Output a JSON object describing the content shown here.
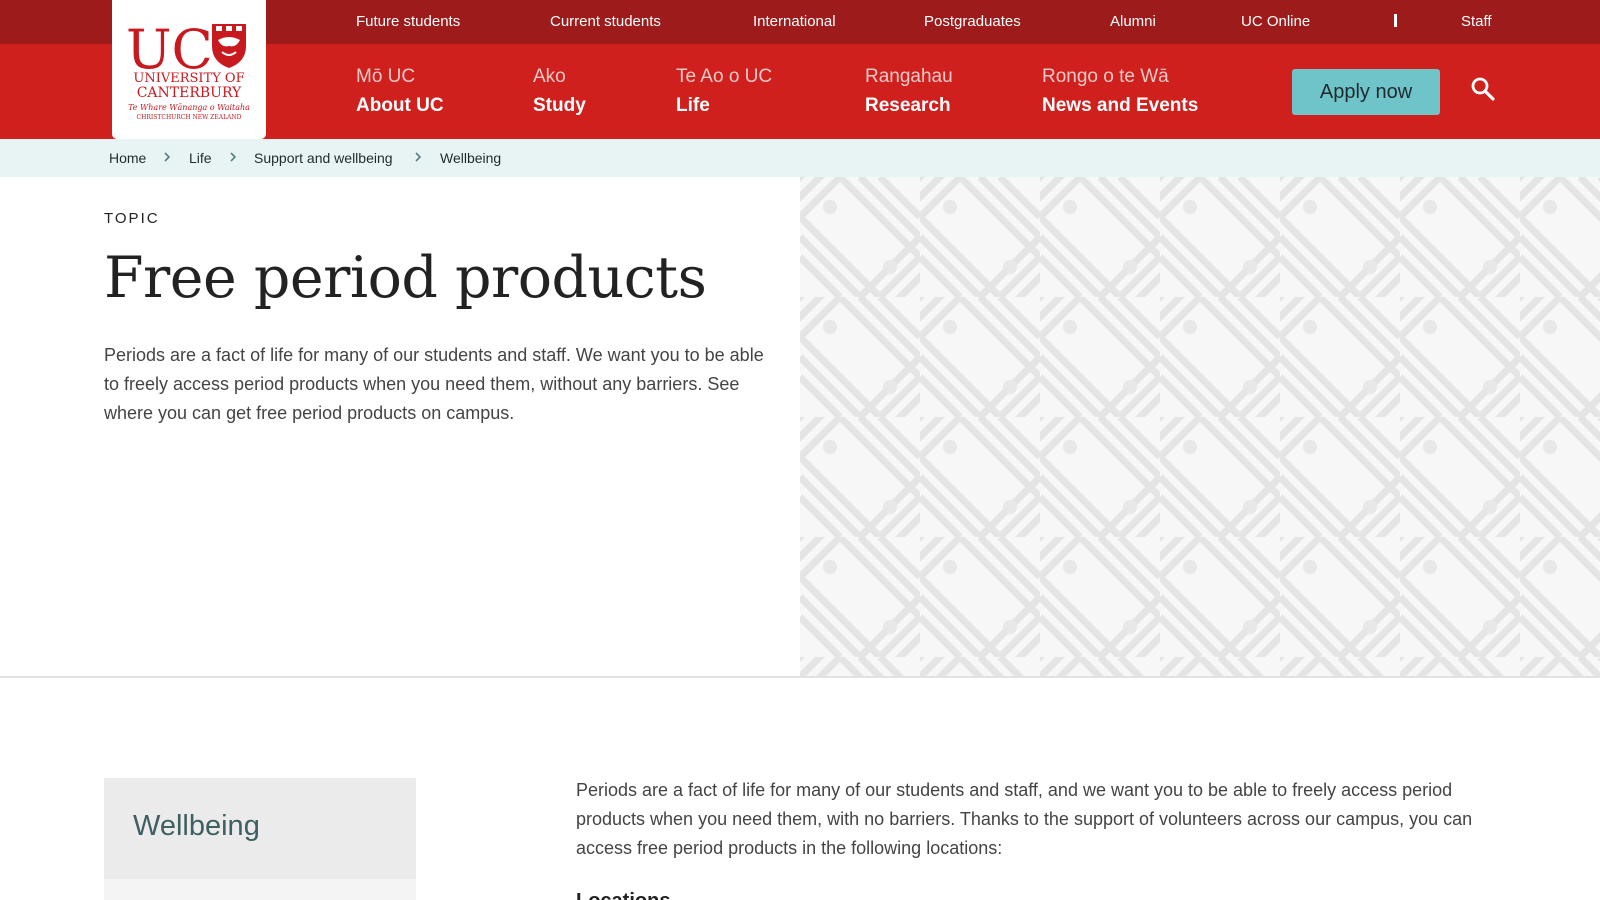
{
  "utility_nav": {
    "items": [
      {
        "label": "Future students"
      },
      {
        "label": "Current students"
      },
      {
        "label": "International"
      },
      {
        "label": "Postgraduates"
      },
      {
        "label": "Alumni"
      },
      {
        "label": "UC Online"
      },
      {
        "label": "Staff"
      }
    ]
  },
  "logo": {
    "line1": "UC",
    "line2": "UNIVERSITY OF",
    "line3": "CANTERBURY",
    "line4": "Te Whare Wānanga o Waitaha",
    "line5": "CHRISTCHURCH NEW ZEALAND",
    "icon": "university-crest-icon"
  },
  "main_nav": {
    "items": [
      {
        "maori": "Mō UC",
        "english": "About UC"
      },
      {
        "maori": "Ako",
        "english": "Study"
      },
      {
        "maori": "Te Ao o UC",
        "english": "Life"
      },
      {
        "maori": "Rangahau",
        "english": "Research"
      },
      {
        "maori": "Rongo o te Wā",
        "english": "News and Events"
      }
    ],
    "apply_label": "Apply now",
    "search_icon": "search-icon"
  },
  "breadcrumb": {
    "items": [
      {
        "label": "Home"
      },
      {
        "label": "Life"
      },
      {
        "label": "Support and wellbeing"
      },
      {
        "label": "Wellbeing"
      }
    ],
    "separator_icon": "chevron-right-icon"
  },
  "hero": {
    "eyebrow": "TOPIC",
    "title": "Free period products",
    "intro": "Periods are a fact of life for many of our students and staff. We want you to be able to freely access period products when you need them, without any barriers. See where you can get free period products on campus.",
    "pattern_icon": "woven-pattern-graphic"
  },
  "side_nav": {
    "title": "Wellbeing"
  },
  "content": {
    "paragraph": "Periods are a fact of life for many of our students and staff, and we want you to be able to freely access period products when you need them, with no barriers. Thanks to the support of volunteers across our campus, you can access free period products in the following locations:",
    "section_heading": "Locations"
  },
  "colors": {
    "utility_bar": "#9e1b1b",
    "main_nav": "#d0201e",
    "apply_button": "#6fc4c9",
    "breadcrumb_bg": "#e8f4f4",
    "side_nav_title": "#3f5f62"
  }
}
